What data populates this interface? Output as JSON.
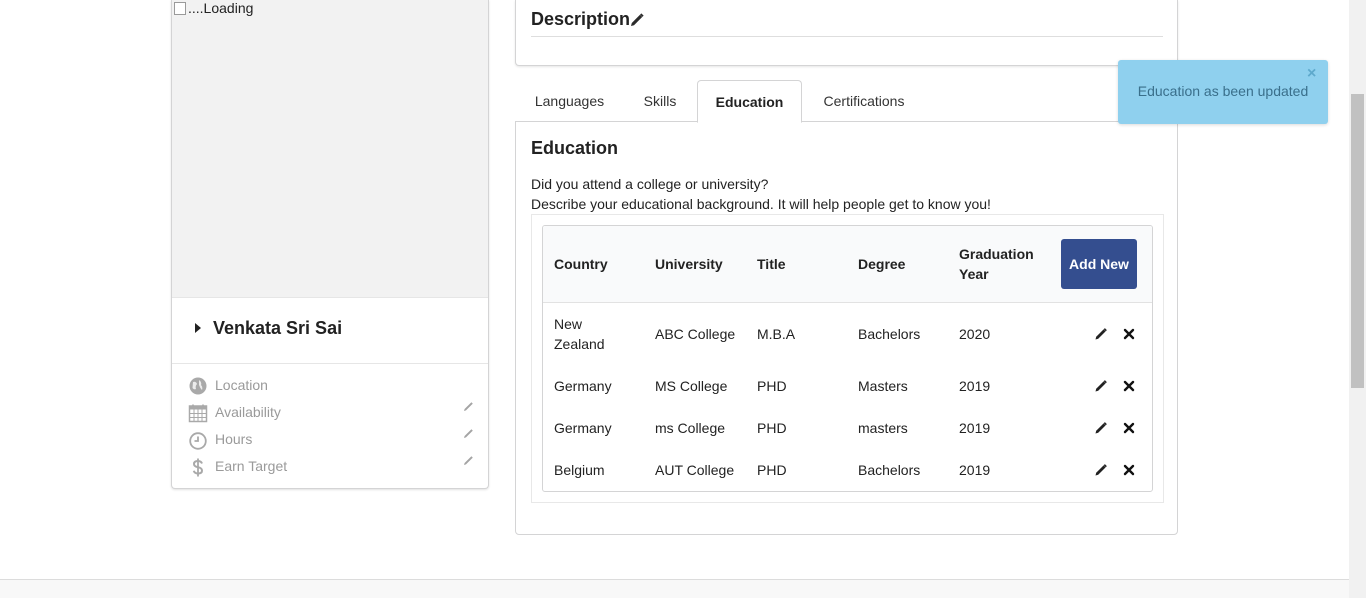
{
  "profile": {
    "photo_alt": "....Loading",
    "name": "Venkata Sri Sai",
    "meta": [
      {
        "label": "Location",
        "icon": "globe-icon",
        "editable": false
      },
      {
        "label": "Availability",
        "icon": "calendar-icon",
        "editable": true
      },
      {
        "label": "Hours",
        "icon": "clock-icon",
        "editable": true
      },
      {
        "label": "Earn Target",
        "icon": "dollar-icon",
        "editable": true
      }
    ]
  },
  "description": {
    "title": "Description"
  },
  "tabs": [
    {
      "label": "Languages",
      "active": false
    },
    {
      "label": "Skills",
      "active": false
    },
    {
      "label": "Education",
      "active": true
    },
    {
      "label": "Certifications",
      "active": false
    }
  ],
  "education": {
    "title": "Education",
    "prompt": "Did you attend a college or university?",
    "subtitle": "Describe your educational background. It will help people get to know you!",
    "add_button": "Add New",
    "columns": [
      "Country",
      "University",
      "Title",
      "Degree",
      "Graduation Year"
    ],
    "rows": [
      {
        "country": "New Zealand",
        "university": "ABC College",
        "title": "M.B.A",
        "degree": "Bachelors",
        "year": "2020"
      },
      {
        "country": "Germany",
        "university": "MS College",
        "title": "PHD",
        "degree": "Masters",
        "year": "2019"
      },
      {
        "country": "Germany",
        "university": "ms College",
        "title": "PHD",
        "degree": "masters",
        "year": "2019"
      },
      {
        "country": "Belgium",
        "university": "AUT College",
        "title": "PHD",
        "degree": "Bachelors",
        "year": "2019"
      }
    ]
  },
  "toast": {
    "message": "Education as been updated",
    "close": "×"
  },
  "colors": {
    "primary_button": "#344e8f",
    "toast_bg": "#8fd0ee",
    "toast_text": "#3a6f8b"
  }
}
